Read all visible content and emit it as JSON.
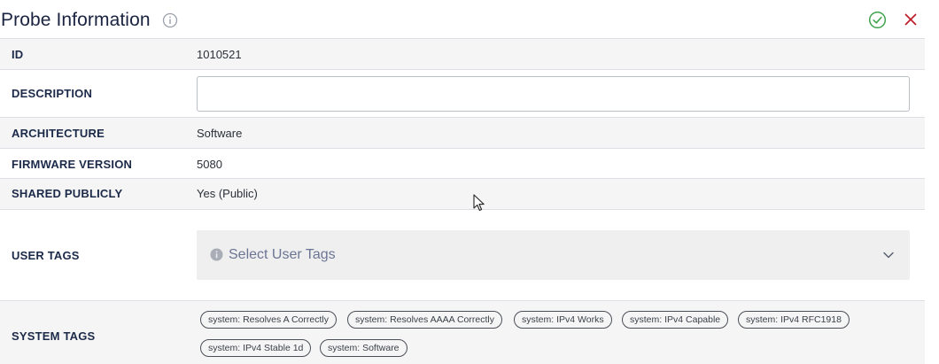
{
  "header": {
    "title": "Probe Information",
    "info_icon": "info-icon",
    "confirm_icon": "check-circle-icon",
    "close_icon": "close-icon",
    "confirm_color": "#3fa34d",
    "close_color": "#c0202e"
  },
  "rows": {
    "id": {
      "label": "ID",
      "value": "1010521"
    },
    "description": {
      "label": "DESCRIPTION",
      "value": "",
      "placeholder": ""
    },
    "architecture": {
      "label": "ARCHITECTURE",
      "value": "Software"
    },
    "firmware": {
      "label": "FIRMWARE VERSION",
      "value": "5080"
    },
    "shared": {
      "label": "SHARED PUBLICLY",
      "value": "Yes (Public)"
    },
    "user_tags": {
      "label": "USER TAGS",
      "placeholder": "Select User Tags"
    },
    "system_tags": {
      "label": "SYSTEM TAGS",
      "tags": [
        "system: Resolves A Correctly",
        "system: Resolves AAAA Correctly",
        "system: IPv4 Works",
        "system: IPv4 Capable",
        "system: IPv4 RFC1918",
        "system: IPv4 Stable 1d",
        "system: Software"
      ]
    }
  }
}
